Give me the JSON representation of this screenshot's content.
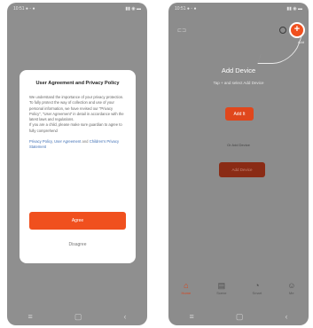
{
  "left_screen": {
    "status_time": "10:51 ● ◦ ●",
    "status_icons": "▮▮ ◉ ▬",
    "dialog": {
      "title": "User Agreement and Privacy Policy",
      "body": "We understand the importance of your privacy protection. To fully protect the way of collection and use of your personal information, we have revised our \"Privacy Policy\", \"User Agreement\" in detail in accordance with the latest laws and regulations.\nIf you are a child, please make sure guardian to agree to fully comprehend",
      "links_text_1": "Privacy Policy",
      "links_sep_1": ", ",
      "links_text_2": "User Agreement",
      "links_sep_2": " and ",
      "links_text_3": "Children's Privacy Statement",
      "agree_label": "Agree",
      "disagree_label": "Disagree"
    },
    "nav": {
      "menu": "≡",
      "home": "▢",
      "back": "‹"
    }
  },
  "right_screen": {
    "status_time": "10:51 ● ◦ ●",
    "status_icons": "▮▮ ◉ ▬",
    "scan_icon_text": "⊏⊐",
    "plus_symbol": "+",
    "plus_caption": "Add",
    "add_device_title": "Add Device",
    "add_device_subtitle": "Tap + and select Add Device",
    "add_it_label": "Add It",
    "or_text": "Or Add Device",
    "other_button_label": "Add Device",
    "tabs": [
      {
        "icon": "⌂",
        "label": "Home"
      },
      {
        "icon": "▤",
        "label": "Scene"
      },
      {
        "icon": "◔",
        "label": "Smart"
      },
      {
        "icon": "☺",
        "label": "Me"
      }
    ],
    "nav": {
      "menu": "≡",
      "home": "▢",
      "back": "‹"
    },
    "accent_color": "#f0501e"
  }
}
